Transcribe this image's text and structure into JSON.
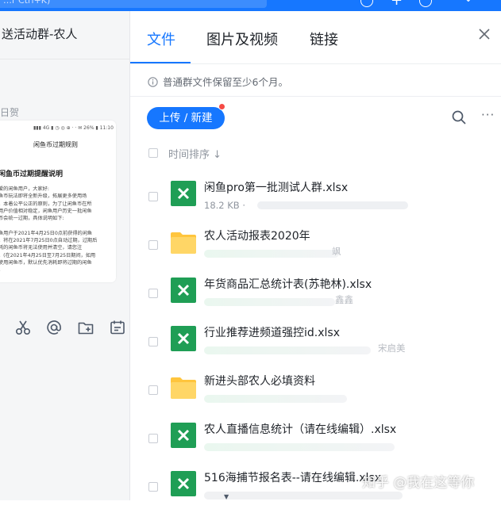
{
  "window": {
    "search_text": "…r Ctrl+K)",
    "accent": "#1677ff"
  },
  "chat": {
    "title": "送活动群-农人",
    "sender": "日贺",
    "image": {
      "status": "▮▮▮ 4G ▮ ◷ ◎ ⊕ · · ✉ 26% ▮ 11:10",
      "heading": "闲鱼币过期规则",
      "subheading": "闲鱼币过期提醒说明",
      "lines": [
        "爱的闲鱼用户，大家好:",
        "鱼币玩法即将全新升级，拓展更多使用场",
        "。本着公平公正的原则，为了让闲鱼币在所",
        "用户价值相对稳定，闲鱼用户历史一批闲鱼",
        "币会统一过期，具体说明如下:",
        "",
        "鱼用户于2021年4月25日0点前获得的闲鱼",
        "。将在2021年7月25日0点自动过期，过期后",
        "耗的闲鱼币将无法使用并清空，请您注",
        "。(在2021年4月25日至7月25日期间，如用",
        "使用闲鱼币，默认优先消耗即将过期的闲鱼",
        "。"
      ]
    },
    "toolbar_icons": [
      "scissors-icon",
      "at-icon",
      "folder-add-icon",
      "calendar-icon"
    ]
  },
  "files_panel": {
    "tabs": [
      {
        "label": "文件",
        "active": true
      },
      {
        "label": "图片及视频",
        "active": false
      },
      {
        "label": "链接",
        "active": false
      }
    ],
    "notice": "普通群文件保留至少6个月。",
    "upload_label": "上传 / 新建",
    "sort_label": "时间排序 ↓",
    "files": [
      {
        "name": "闲鱼pro第一批测试人群.xlsx",
        "type": "excel",
        "meta": "18.2 KB  ·",
        "owner": ""
      },
      {
        "name": "农人活动报表2020年",
        "type": "folder",
        "meta": "",
        "owner": "飒"
      },
      {
        "name": "年货商品汇总统计表(苏艳林).xlsx",
        "type": "excel",
        "meta": "",
        "owner": "鑫鑫"
      },
      {
        "name": "行业推荐进频道强控id.xlsx",
        "type": "excel",
        "meta": "",
        "owner": "宋启美"
      },
      {
        "name": "新进头部农人必填资料",
        "type": "folder",
        "meta": "",
        "owner": ""
      },
      {
        "name": "农人直播信息统计（请在线编辑）.xlsx",
        "type": "excel",
        "meta": "",
        "owner": ""
      },
      {
        "name": "516海捕节报名表--请在线编辑.xlsx",
        "type": "excel",
        "meta": "",
        "owner": ""
      }
    ]
  },
  "watermark": "知乎 @我在这等你"
}
